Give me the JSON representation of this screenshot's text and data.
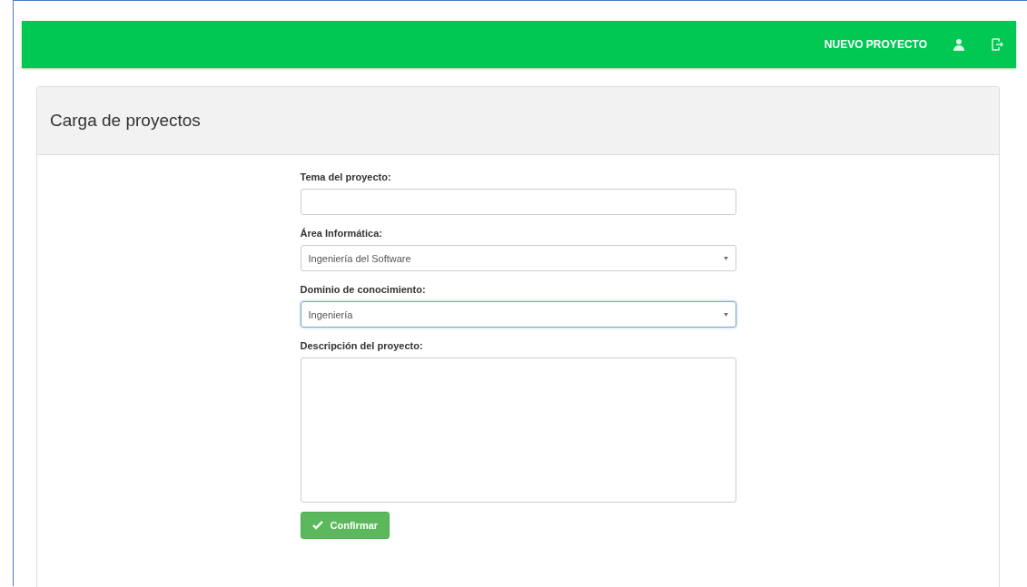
{
  "navbar": {
    "items": [
      {
        "label": "NUEVO PROYECTO",
        "selected": true
      }
    ],
    "icons": [
      {
        "kind": "user"
      },
      {
        "kind": "exit"
      }
    ]
  },
  "panel": {
    "title": "Carga de proyectos"
  },
  "form": {
    "fields": [
      {
        "kind": "text",
        "label": "Tema del proyecto:",
        "focused": false
      },
      {
        "kind": "select",
        "label": "Área Informática:",
        "value": "Ingeniería del Software",
        "focused": false
      },
      {
        "kind": "select",
        "label": "Dominio de conocimiento:",
        "value": "Ingeniería",
        "focused": true
      },
      {
        "kind": "textarea",
        "label": "Descripción del proyecto:",
        "focused": false
      }
    ],
    "submit": "Confirmar"
  }
}
